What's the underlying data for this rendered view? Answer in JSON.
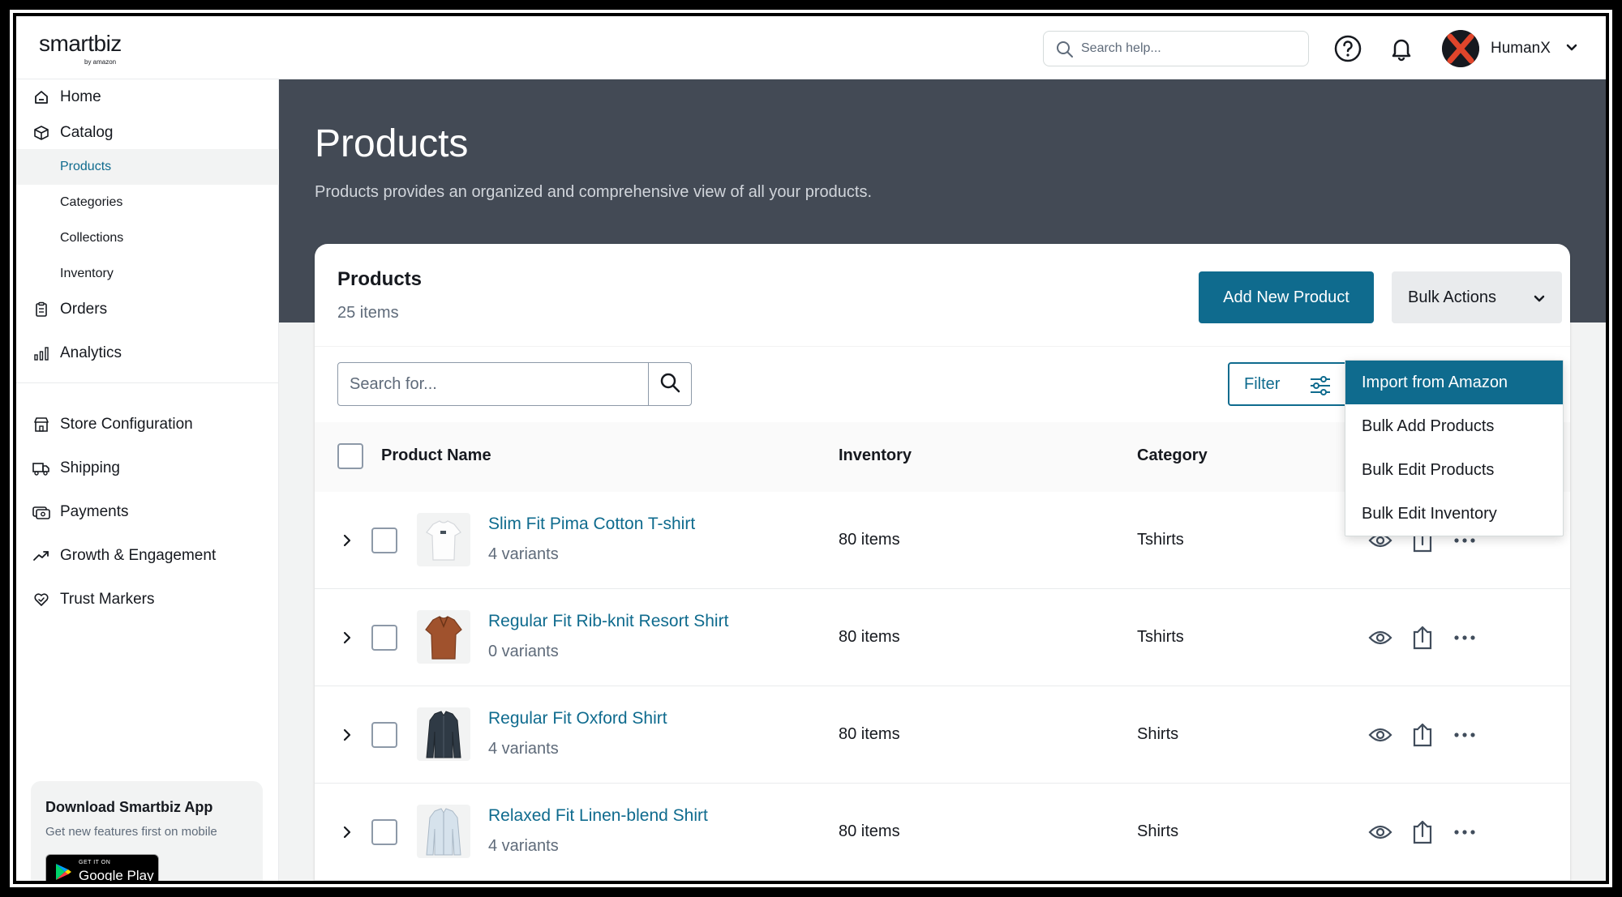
{
  "header": {
    "logo": "smartbiz",
    "logo_sub": "by amazon",
    "search_placeholder": "Search help...",
    "user_name": "HumanX"
  },
  "sidebar": {
    "items": [
      {
        "label": "Home",
        "icon": "home-icon"
      },
      {
        "label": "Catalog",
        "icon": "box-icon"
      },
      {
        "label": "Orders",
        "icon": "clipboard-icon"
      },
      {
        "label": "Analytics",
        "icon": "bar-chart-icon"
      },
      {
        "label": "Store Configuration",
        "icon": "store-icon"
      },
      {
        "label": "Shipping",
        "icon": "truck-icon"
      },
      {
        "label": "Payments",
        "icon": "payment-icon"
      },
      {
        "label": "Growth & Engagement",
        "icon": "trend-up-icon"
      },
      {
        "label": "Trust Markers",
        "icon": "trust-icon"
      }
    ],
    "catalog_sub": [
      "Products",
      "Categories",
      "Collections",
      "Inventory"
    ],
    "promo": {
      "title": "Download Smartbiz App",
      "subtitle": "Get new features first on mobile",
      "badge_small": "GET IT ON",
      "badge_big": "Google Play"
    }
  },
  "page": {
    "title": "Products",
    "description": "Products provides an organized and comprehensive view of all your products."
  },
  "card": {
    "title": "Products",
    "count": "25 items",
    "add_button": "Add New Product",
    "bulk_button": "Bulk Actions",
    "search_placeholder": "Search for...",
    "filter_button": "Filter"
  },
  "table": {
    "columns": [
      "Product Name",
      "Inventory",
      "Category"
    ],
    "rows": [
      {
        "name": "Slim Fit Pima Cotton T-shirt",
        "variants": "4 variants",
        "inventory": "80 items",
        "category": "Tshirts"
      },
      {
        "name": "Regular Fit Rib-knit Resort Shirt",
        "variants": "0 variants",
        "inventory": "80 items",
        "category": "Tshirts"
      },
      {
        "name": "Regular Fit Oxford Shirt",
        "variants": "4 variants",
        "inventory": "80 items",
        "category": "Shirts"
      },
      {
        "name": "Relaxed Fit Linen-blend Shirt",
        "variants": "4 variants",
        "inventory": "80 items",
        "category": "Shirts"
      }
    ]
  },
  "bulk_menu": {
    "items": [
      "Import from Amazon",
      "Bulk Add Products",
      "Bulk Edit Products",
      "Bulk Edit Inventory"
    ],
    "highlighted": "Import from Amazon"
  },
  "colors": {
    "accent": "#0f6b8e",
    "hero": "#434a55",
    "sidebar_active": "#f2f3f3"
  }
}
